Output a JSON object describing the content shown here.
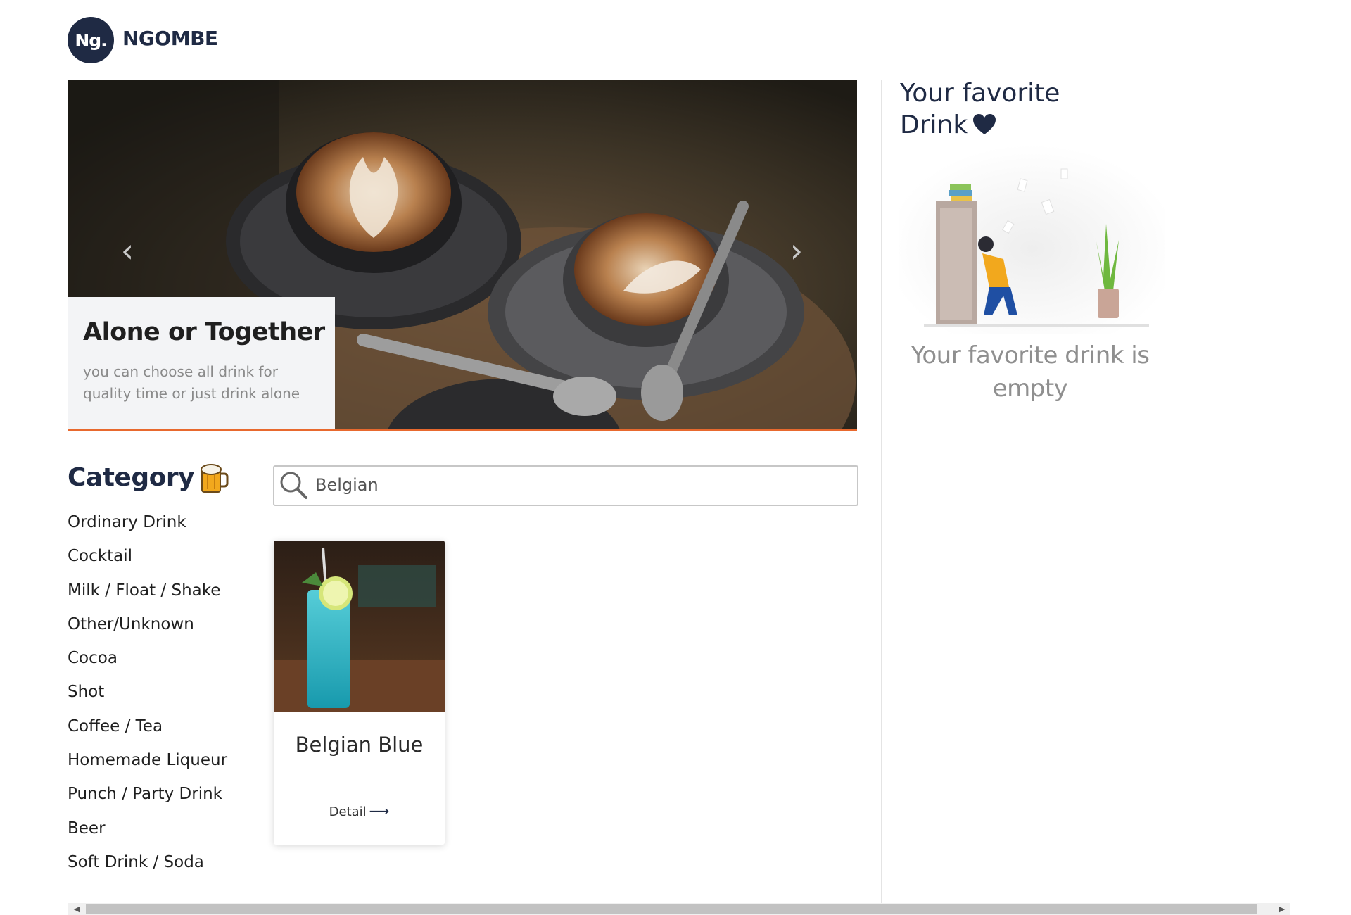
{
  "header": {
    "logo_text": "Ng.",
    "brand": "NGOMBE"
  },
  "hero": {
    "title": "Alone or Together",
    "subtitle": "you can choose all drink for quality time or just drink alone",
    "prev_icon": "chevron-left-icon",
    "next_icon": "chevron-right-icon",
    "accent_color": "#e8692e"
  },
  "category": {
    "title": "Category",
    "icon": "beer-icon",
    "items": [
      "Ordinary Drink",
      "Cocktail",
      "Milk / Float / Shake",
      "Other/Unknown",
      "Cocoa",
      "Shot",
      "Coffee / Tea",
      "Homemade Liqueur",
      "Punch / Party Drink",
      "Beer",
      "Soft Drink / Soda"
    ]
  },
  "search": {
    "value": "Belgian",
    "icon": "search-icon"
  },
  "results": [
    {
      "name": "Belgian Blue",
      "detail_label": "Detail"
    }
  ],
  "favorites": {
    "title": "Your favorite Drink",
    "empty_text": "Your favorite drink is empty",
    "heart_color": "#1f2a44"
  }
}
